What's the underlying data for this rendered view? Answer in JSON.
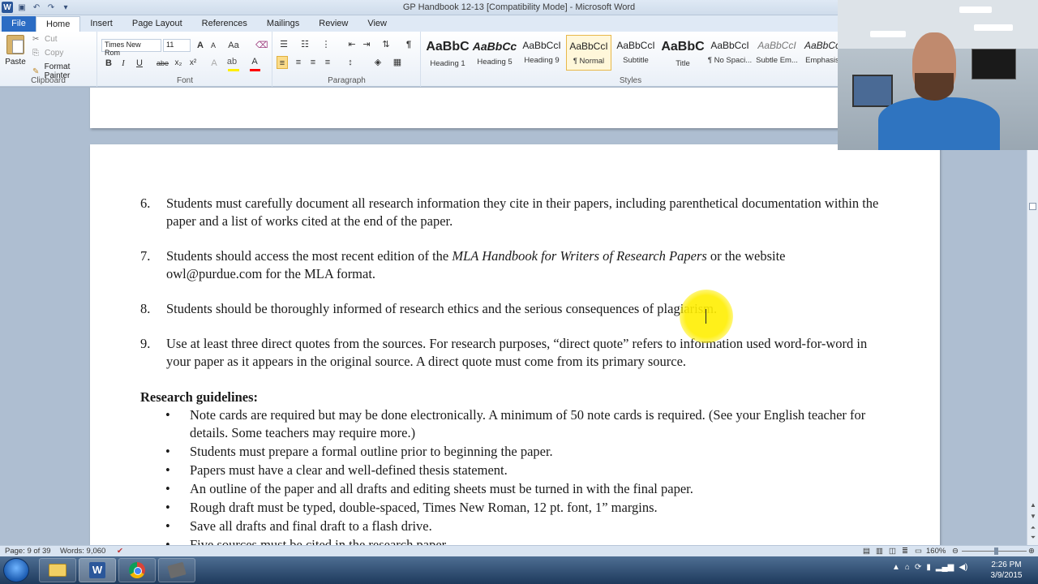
{
  "window": {
    "title": "GP Handbook 12-13 [Compatibility Mode] - Microsoft Word"
  },
  "tabs": [
    "File",
    "Home",
    "Insert",
    "Page Layout",
    "References",
    "Mailings",
    "Review",
    "View"
  ],
  "ribbon": {
    "clipboard": {
      "paste": "Paste",
      "cut": "Cut",
      "copy": "Copy",
      "format_painter": "Format Painter",
      "label": "Clipboard"
    },
    "font": {
      "name": "Times New Rom",
      "size": "11",
      "label": "Font",
      "bold": "B",
      "italic": "I",
      "underline": "U",
      "strike": "abe",
      "subscript": "x₂",
      "superscript": "x²",
      "grow": "A",
      "shrink": "A",
      "change_case": "Aa",
      "font_color": "A",
      "highlight_color": "#ffee00",
      "font_color_value": "#ff0000"
    },
    "paragraph": {
      "label": "Paragraph"
    },
    "styles": {
      "label": "Styles",
      "items": [
        {
          "preview": "AaBbC",
          "name": "Heading 1"
        },
        {
          "preview": "AaBbCc",
          "name": "Heading 5"
        },
        {
          "preview": "AaBbCcI",
          "name": "Heading 9"
        },
        {
          "preview": "AaBbCcI",
          "name": "¶ Normal"
        },
        {
          "preview": "AaBbCcI",
          "name": "Subtitle"
        },
        {
          "preview": "AaBbC",
          "name": "Title"
        },
        {
          "preview": "AaBbCcI",
          "name": "¶ No Spaci..."
        },
        {
          "preview": "AaBbCcI",
          "name": "Subtle Em..."
        },
        {
          "preview": "AaBbCc",
          "name": "Emphasis"
        }
      ],
      "selected_index": 3
    }
  },
  "document": {
    "numbered_items": [
      {
        "num": "6.",
        "text": "Students must carefully document all research information they cite in their papers, including parenthetical documentation within the paper and a list of works cited at the end of the paper."
      },
      {
        "num": "7.",
        "text_before": "Students should access the most recent edition of the ",
        "italic": "MLA Handbook for Writers of Research Papers",
        "text_after": " or the website owl@purdue.com for the MLA format."
      },
      {
        "num": "8.",
        "text": "Students should be thoroughly informed of research ethics and the serious consequences of plagiarism."
      },
      {
        "num": "9.",
        "text": "Use at least three direct quotes from the sources. For research purposes, “direct quote” refers to information used word-for-word in your paper as it appears in the original source. A direct quote must come from its primary source."
      }
    ],
    "heading": "Research guidelines:",
    "bullets": [
      "Note cards are required but may be done electronically.  A minimum of 50 note cards is required.  (See your English teacher for details. Some teachers may require more.)",
      "Students must prepare a formal outline prior to beginning the paper.",
      "Papers must have a clear and well-defined thesis statement.",
      "An outline of the paper and all drafts and editing sheets must be turned in with the final paper.",
      "Rough draft must be typed, double-spaced, Times New Roman, 12 pt. font, 1” margins.",
      "Save all drafts and final draft to a flash drive.",
      "Five sources must be cited in the research paper."
    ],
    "bullet_glyph": "•"
  },
  "statusbar": {
    "page": "Page: 9 of 39",
    "words": "Words: 9,060",
    "zoom": "160%"
  },
  "taskbar": {
    "time": "2:26 PM",
    "date": "3/9/2015"
  },
  "icons": {
    "save": "save-icon",
    "undo": "undo-icon",
    "redo": "redo-icon"
  }
}
